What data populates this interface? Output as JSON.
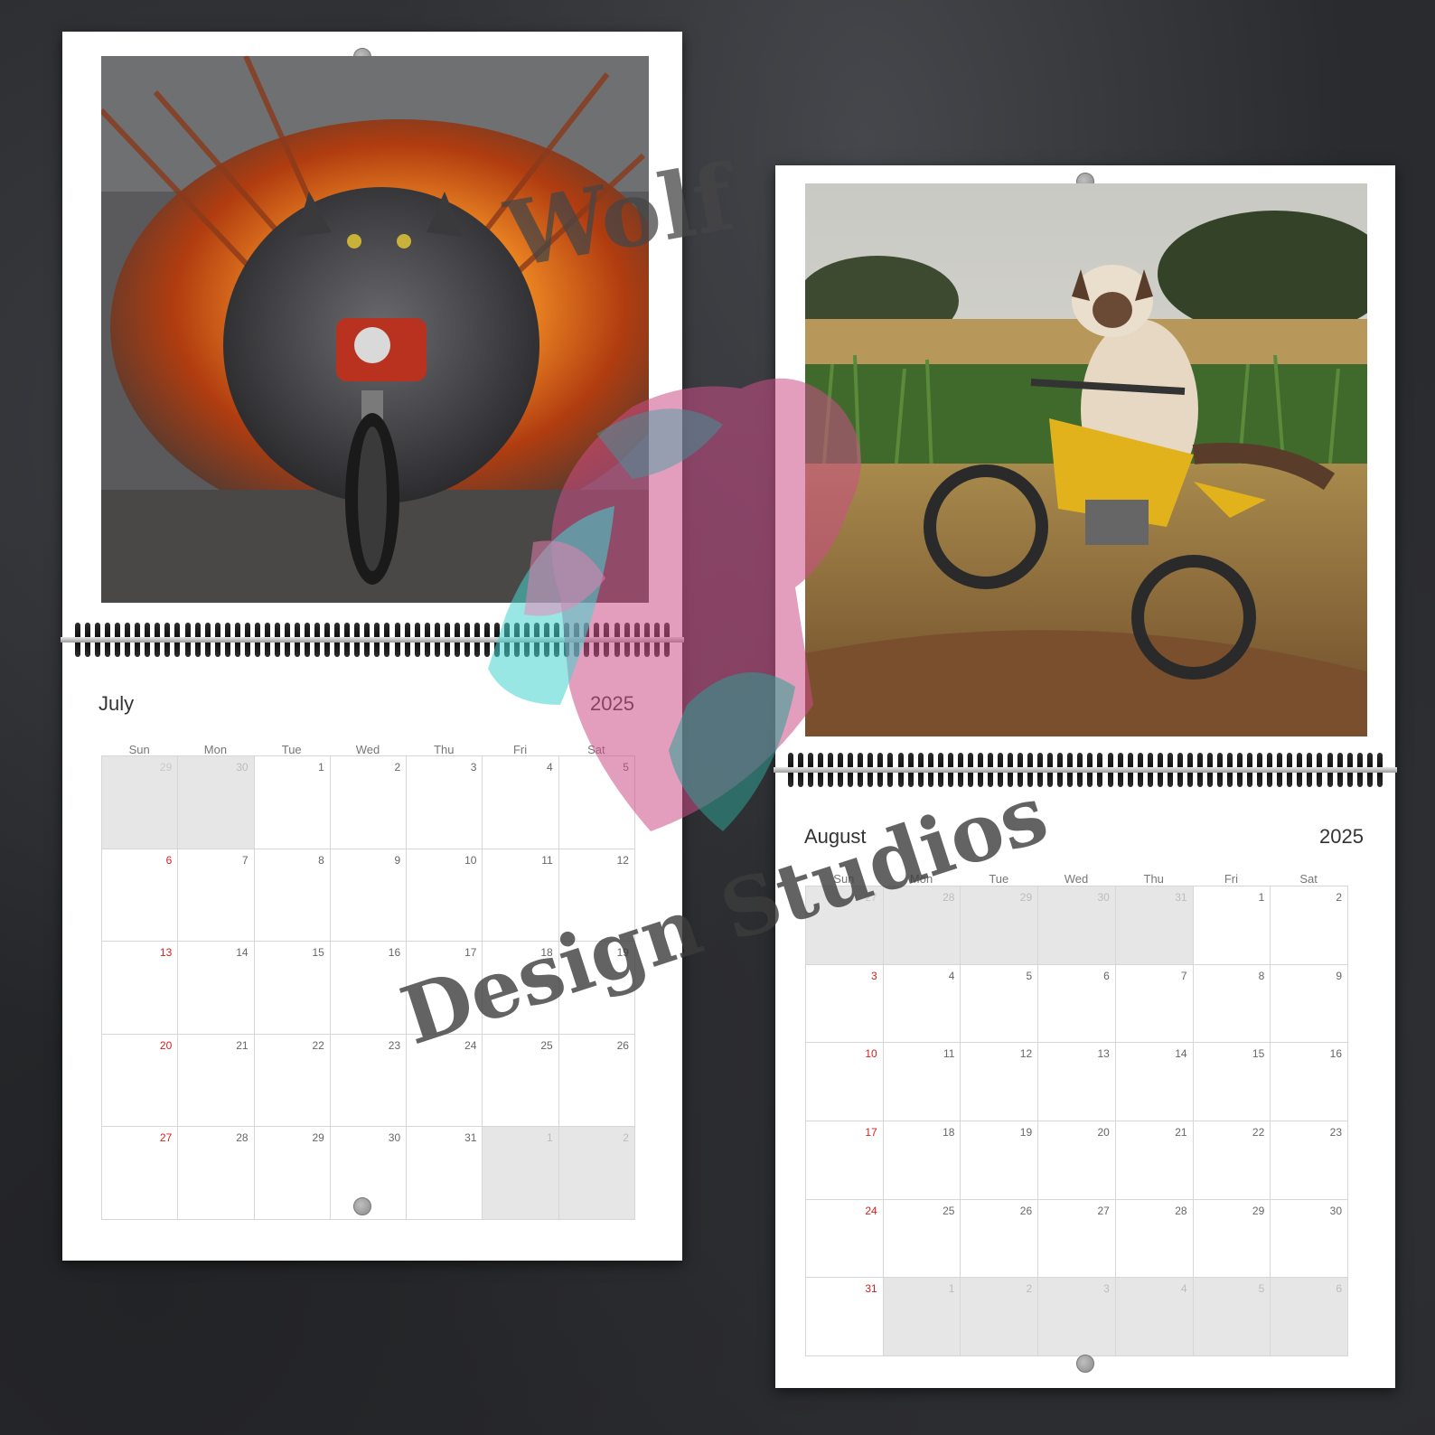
{
  "july": {
    "month": "July",
    "year": "2025",
    "weekdays": [
      "Sun",
      "Mon",
      "Tue",
      "Wed",
      "Thu",
      "Fri",
      "Sat"
    ],
    "days": [
      {
        "n": "29",
        "o": 1
      },
      {
        "n": "30",
        "o": 1
      },
      {
        "n": "1"
      },
      {
        "n": "2"
      },
      {
        "n": "3"
      },
      {
        "n": "4"
      },
      {
        "n": "5"
      },
      {
        "n": "6"
      },
      {
        "n": "7"
      },
      {
        "n": "8"
      },
      {
        "n": "9"
      },
      {
        "n": "10"
      },
      {
        "n": "11"
      },
      {
        "n": "12"
      },
      {
        "n": "13"
      },
      {
        "n": "14"
      },
      {
        "n": "15"
      },
      {
        "n": "16"
      },
      {
        "n": "17"
      },
      {
        "n": "18"
      },
      {
        "n": "19"
      },
      {
        "n": "20"
      },
      {
        "n": "21"
      },
      {
        "n": "22"
      },
      {
        "n": "23"
      },
      {
        "n": "24"
      },
      {
        "n": "25"
      },
      {
        "n": "26"
      },
      {
        "n": "27"
      },
      {
        "n": "28"
      },
      {
        "n": "29"
      },
      {
        "n": "30"
      },
      {
        "n": "31"
      },
      {
        "n": "1",
        "o": 1
      },
      {
        "n": "2",
        "o": 1
      }
    ]
  },
  "august": {
    "month": "August",
    "year": "2025",
    "weekdays": [
      "Sun",
      "Mon",
      "Tue",
      "Wed",
      "Thu",
      "Fri",
      "Sat"
    ],
    "days": [
      {
        "n": "27",
        "o": 1
      },
      {
        "n": "28",
        "o": 1
      },
      {
        "n": "29",
        "o": 1
      },
      {
        "n": "30",
        "o": 1
      },
      {
        "n": "31",
        "o": 1
      },
      {
        "n": "1"
      },
      {
        "n": "2"
      },
      {
        "n": "3"
      },
      {
        "n": "4"
      },
      {
        "n": "5"
      },
      {
        "n": "6"
      },
      {
        "n": "7"
      },
      {
        "n": "8"
      },
      {
        "n": "9"
      },
      {
        "n": "10"
      },
      {
        "n": "11"
      },
      {
        "n": "12"
      },
      {
        "n": "13"
      },
      {
        "n": "14"
      },
      {
        "n": "15"
      },
      {
        "n": "16"
      },
      {
        "n": "17"
      },
      {
        "n": "18"
      },
      {
        "n": "19"
      },
      {
        "n": "20"
      },
      {
        "n": "21"
      },
      {
        "n": "22"
      },
      {
        "n": "23"
      },
      {
        "n": "24"
      },
      {
        "n": "25"
      },
      {
        "n": "26"
      },
      {
        "n": "27"
      },
      {
        "n": "28"
      },
      {
        "n": "29"
      },
      {
        "n": "30"
      },
      {
        "n": "31"
      },
      {
        "n": "1",
        "o": 1
      },
      {
        "n": "2",
        "o": 1
      },
      {
        "n": "3",
        "o": 1
      },
      {
        "n": "4",
        "o": 1
      },
      {
        "n": "5",
        "o": 1
      },
      {
        "n": "6",
        "o": 1
      }
    ]
  },
  "watermark": {
    "line1": "Wolf",
    "line2": "Design Studios"
  }
}
